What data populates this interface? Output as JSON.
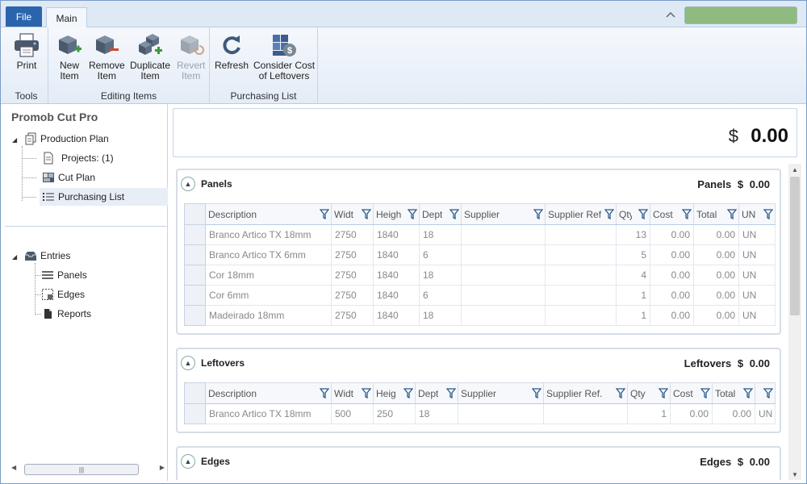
{
  "tabs": {
    "file": "File",
    "main": "Main"
  },
  "colors": {
    "accent": "#2a64ac",
    "status": "#8fba80"
  },
  "ribbon": {
    "groups": [
      {
        "label": "Tools",
        "buttons": [
          {
            "line1": "Print",
            "line2": "",
            "icon": "printer-icon"
          }
        ]
      },
      {
        "label": "Editing Items",
        "buttons": [
          {
            "line1": "New",
            "line2": "Item",
            "icon": "new-item-icon"
          },
          {
            "line1": "Remove",
            "line2": "Item",
            "icon": "remove-item-icon"
          },
          {
            "line1": "Duplicate",
            "line2": "Item",
            "icon": "duplicate-item-icon"
          },
          {
            "line1": "Revert",
            "line2": "Item",
            "icon": "revert-item-icon",
            "disabled": true
          }
        ]
      },
      {
        "label": "Purchasing List",
        "buttons": [
          {
            "line1": "Refresh",
            "line2": "",
            "icon": "refresh-icon"
          },
          {
            "line1": "Consider Cost",
            "line2": "of Leftovers",
            "icon": "leftovers-cost-icon"
          }
        ]
      }
    ]
  },
  "tree": {
    "title": "Promob Cut Pro",
    "production_plan": "Production Plan",
    "projects": "Projects: (1)",
    "cut_plan": "Cut Plan",
    "purchasing_list": "Purchasing List",
    "entries": "Entries",
    "panels": "Panels",
    "edges": "Edges",
    "reports": "Reports"
  },
  "total": {
    "currency": "$",
    "amount": "0.00"
  },
  "sections": {
    "panels": {
      "title": "Panels",
      "total_label": "Panels",
      "currency": "$",
      "total": "0.00",
      "columns": [
        "Description",
        "Widt",
        "Heigh",
        "Dept",
        "Supplier",
        "Supplier Ref",
        "Qty",
        "Cost",
        "Total",
        "UN"
      ],
      "rows": [
        [
          "Branco Artico TX 18mm",
          "2750",
          "1840",
          "18",
          "",
          "",
          "13",
          "0.00",
          "0.00",
          "UN"
        ],
        [
          "Branco Artico TX 6mm",
          "2750",
          "1840",
          "6",
          "",
          "",
          "5",
          "0.00",
          "0.00",
          "UN"
        ],
        [
          "Cor 18mm",
          "2750",
          "1840",
          "18",
          "",
          "",
          "4",
          "0.00",
          "0.00",
          "UN"
        ],
        [
          "Cor 6mm",
          "2750",
          "1840",
          "6",
          "",
          "",
          "1",
          "0.00",
          "0.00",
          "UN"
        ],
        [
          "Madeirado 18mm",
          "2750",
          "1840",
          "18",
          "",
          "",
          "1",
          "0.00",
          "0.00",
          "UN"
        ]
      ]
    },
    "leftovers": {
      "title": "Leftovers",
      "total_label": "Leftovers",
      "currency": "$",
      "total": "0.00",
      "columns": [
        "Description",
        "Widt",
        "Heig",
        "Dept",
        "Supplier",
        "Supplier Ref.",
        "Qty",
        "Cost",
        "Total",
        ""
      ],
      "rows": [
        [
          "Branco Artico TX 18mm",
          "500",
          "250",
          "18",
          "",
          "",
          "1",
          "0.00",
          "0.00",
          "UN"
        ]
      ]
    },
    "edges": {
      "title": "Edges",
      "total_label": "Edges",
      "currency": "$",
      "total": "0.00"
    }
  }
}
